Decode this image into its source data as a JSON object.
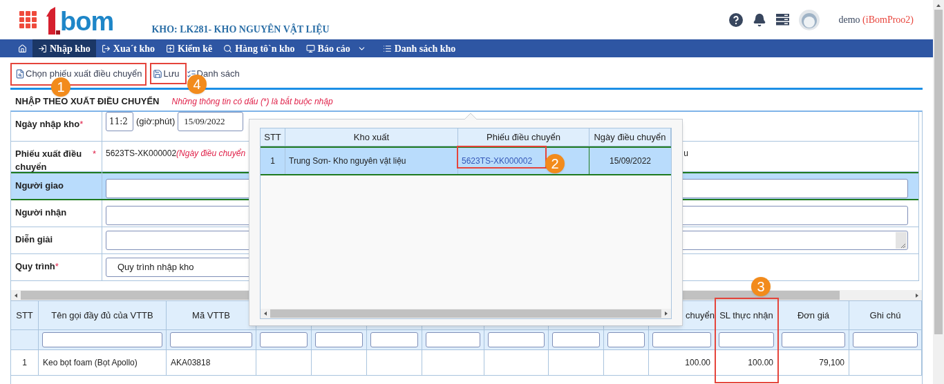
{
  "header": {
    "logo": "bom",
    "warehouse_title": "KHO: LK281- KHO NGUYÊN VẬT LIỆU",
    "user": {
      "name": "demo",
      "account": "(iBomProo2)"
    }
  },
  "nav": [
    {
      "kind": "home",
      "selected": false
    },
    {
      "kind": "link",
      "label": "Nhập kho",
      "selected": true
    },
    {
      "kind": "link",
      "label": "Xua´t kho",
      "selected": false
    },
    {
      "kind": "link",
      "label": "Kiểm kê",
      "selected": false
    },
    {
      "kind": "link",
      "label": "Hàng tô`n kho",
      "selected": false
    },
    {
      "kind": "menu",
      "label": "Báo cáo",
      "selected": false
    },
    {
      "kind": "link",
      "label": "Danh sách kho",
      "selected": false
    }
  ],
  "toolbar": [
    {
      "kind": "pick",
      "label": "Chọn phiếu xuất điều chuyển"
    },
    {
      "kind": "save",
      "label": "Lưu"
    },
    {
      "kind": "list",
      "label": "Danh sách"
    }
  ],
  "section": {
    "title": "NHẬP THEO XUẤT ĐIỀU CHUYỂN",
    "note": "Những thông tin có dấu (*) là bắt buộc nhập"
  },
  "form": [
    {
      "kind": "datetime",
      "label": "Ngày nhập kho",
      "required_mark": "*",
      "time": "11:2",
      "time_unit": "(giờ:phút)",
      "date": "15/09/2022",
      "selected": false
    },
    {
      "kind": "text",
      "label": "Phiếu xuất điều chuyển",
      "required_mark": "*",
      "value": "5623TS-XK000002",
      "note": "(Ngày điều chuyển",
      "tail": "u",
      "selected": false
    },
    {
      "kind": "input",
      "label": "Người giao",
      "selected": true
    },
    {
      "kind": "input",
      "label": "Người nhận",
      "selected": false
    },
    {
      "kind": "textarea",
      "label": "Diễn giải",
      "selected": false
    },
    {
      "kind": "select",
      "label": "Quy trình",
      "required_mark": "*",
      "value": "Quy trình nhập kho",
      "selected": false
    }
  ],
  "table": {
    "columns": [
      {
        "label": "STT"
      },
      {
        "label": "Tên gọi đầy đủ của VTTB"
      },
      {
        "label": "Mã VTTB"
      },
      {},
      {},
      {},
      {},
      {},
      {},
      {},
      {
        "label": "chuyển"
      },
      {
        "label": "SL thực nhận"
      },
      {
        "label": "Đơn giá"
      },
      {
        "label": "Ghi chú"
      }
    ],
    "rows": [
      {
        "cells": [
          {
            "text": "1"
          },
          {
            "text": "Keo bọt foam (Bọt Apollo)"
          },
          {
            "text": "AKA03818"
          },
          {},
          {},
          {},
          {},
          {},
          {},
          {},
          {
            "text": "100.00"
          },
          {
            "text": "100.00"
          },
          {
            "text": "79,100"
          },
          {}
        ]
      }
    ]
  },
  "popup": {
    "columns": [
      "STT",
      "Kho xuất",
      "Phiếu điều chuyển",
      "Ngày điều chuyển"
    ],
    "rows": [
      {
        "stt": "1",
        "warehouse": "Trung Sơn- Kho nguyên vật liệu",
        "voucher": "5623TS-XK000002",
        "date": "15/09/2022",
        "selected": true
      }
    ]
  },
  "annotations": [
    {
      "label": "1"
    },
    {
      "label": "4"
    },
    {
      "label": "2"
    },
    {
      "label": "3"
    }
  ]
}
